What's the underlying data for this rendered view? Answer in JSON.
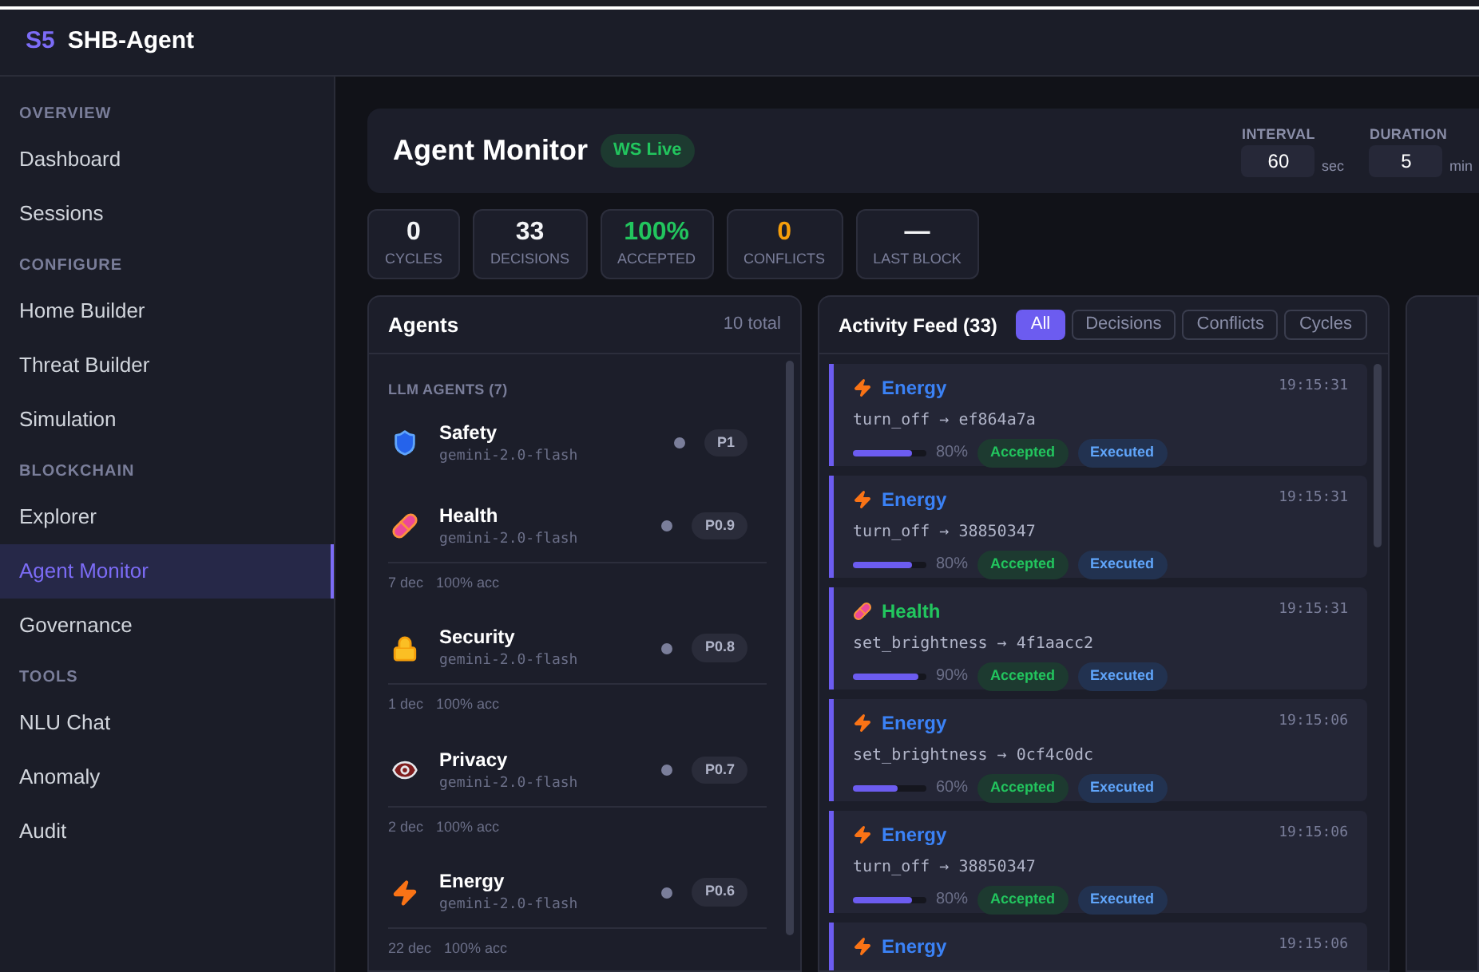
{
  "app": {
    "logo": "S5",
    "title": "SHB-Agent"
  },
  "sidebar": [
    {
      "heading": "OVERVIEW",
      "items": [
        {
          "label": "Dashboard",
          "selected": false
        },
        {
          "label": "Sessions",
          "selected": false
        }
      ]
    },
    {
      "heading": "CONFIGURE",
      "items": [
        {
          "label": "Home Builder",
          "selected": false
        },
        {
          "label": "Threat Builder",
          "selected": false
        },
        {
          "label": "Simulation",
          "selected": false
        }
      ]
    },
    {
      "heading": "BLOCKCHAIN",
      "items": [
        {
          "label": "Explorer",
          "selected": false
        },
        {
          "label": "Agent Monitor",
          "selected": true
        },
        {
          "label": "Governance",
          "selected": false
        }
      ]
    },
    {
      "heading": "TOOLS",
      "items": [
        {
          "label": "NLU Chat",
          "selected": false
        },
        {
          "label": "Anomaly",
          "selected": false
        },
        {
          "label": "Audit",
          "selected": false
        }
      ]
    }
  ],
  "header": {
    "title": "Agent Monitor",
    "badge": "WS Live",
    "interval": {
      "label": "INTERVAL",
      "value": "60",
      "unit": "sec"
    },
    "duration": {
      "label": "DURATION",
      "value": "5",
      "unit": "min"
    }
  },
  "stats": [
    {
      "value": "0",
      "label": "CYCLES",
      "color": "#f3f4f6"
    },
    {
      "value": "33",
      "label": "DECISIONS",
      "color": "#f3f4f6"
    },
    {
      "value": "100%",
      "label": "ACCEPTED",
      "color": "#22c55e"
    },
    {
      "value": "0",
      "label": "CONFLICTS",
      "color": "#f59e0b"
    },
    {
      "value": "—",
      "label": "LAST BLOCK",
      "color": "#f3f4f6"
    }
  ],
  "agents": {
    "title": "Agents",
    "total": "10 total",
    "group": "LLM AGENTS (7)",
    "items": [
      {
        "kind": "safety",
        "name": "Safety",
        "model": "gemini-2.0-flash",
        "priority": "P1"
      },
      {
        "kind": "health",
        "name": "Health",
        "model": "gemini-2.0-flash",
        "priority": "P0.9",
        "decisions": "7 dec",
        "accuracy": "100% acc"
      },
      {
        "kind": "security",
        "name": "Security",
        "model": "gemini-2.0-flash",
        "priority": "P0.8",
        "decisions": "1 dec",
        "accuracy": "100% acc"
      },
      {
        "kind": "privacy",
        "name": "Privacy",
        "model": "gemini-2.0-flash",
        "priority": "P0.7",
        "decisions": "2 dec",
        "accuracy": "100% acc"
      },
      {
        "kind": "energy",
        "name": "Energy",
        "model": "gemini-2.0-flash",
        "priority": "P0.6",
        "decisions": "22 dec",
        "accuracy": "100% acc"
      }
    ]
  },
  "feed": {
    "title": "Activity Feed (33)",
    "filters": [
      {
        "label": "All",
        "selected": true
      },
      {
        "label": "Decisions",
        "selected": false
      },
      {
        "label": "Conflicts",
        "selected": false
      },
      {
        "label": "Cycles",
        "selected": false
      }
    ],
    "items": [
      {
        "kind": "energy",
        "agent": "Energy",
        "color": "#3b82f6",
        "time": "19:15:31",
        "action": "turn_off → ef864a7a",
        "level": 0.8,
        "reading": "80%",
        "tags": [
          "Accepted",
          "Executed"
        ]
      },
      {
        "kind": "energy",
        "agent": "Energy",
        "color": "#3b82f6",
        "time": "19:15:31",
        "action": "turn_off → 38850347",
        "level": 0.8,
        "reading": "80%",
        "tags": [
          "Accepted",
          "Executed"
        ]
      },
      {
        "kind": "health",
        "agent": "Health",
        "color": "#22c55e",
        "time": "19:15:31",
        "action": "set_brightness → 4f1aacc2",
        "level": 0.9,
        "reading": "90%",
        "tags": [
          "Accepted",
          "Executed"
        ]
      },
      {
        "kind": "energy",
        "agent": "Energy",
        "color": "#3b82f6",
        "time": "19:15:06",
        "action": "set_brightness → 0cf4c0dc",
        "level": 0.6,
        "reading": "60%",
        "tags": [
          "Accepted",
          "Executed"
        ]
      },
      {
        "kind": "energy",
        "agent": "Energy",
        "color": "#3b82f6",
        "time": "19:15:06",
        "action": "turn_off → 38850347",
        "level": 0.8,
        "reading": "80%",
        "tags": [
          "Accepted",
          "Executed"
        ]
      },
      {
        "kind": "energy",
        "agent": "Energy",
        "color": "#3b82f6",
        "time": "19:15:06"
      }
    ]
  }
}
